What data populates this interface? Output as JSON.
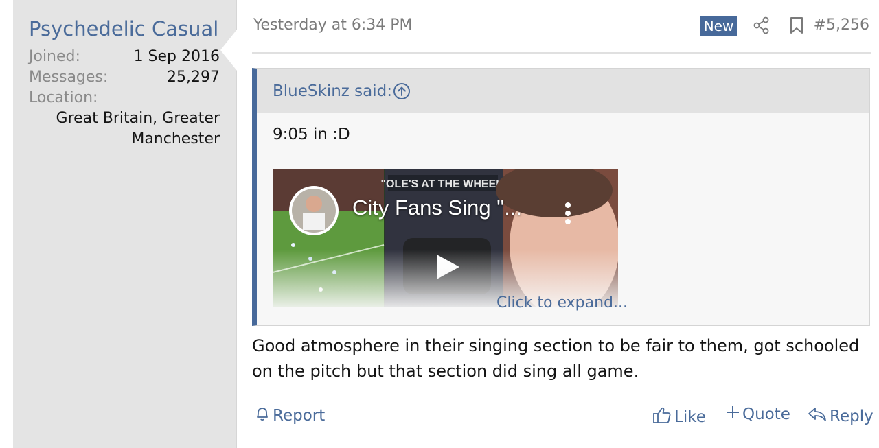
{
  "user": {
    "name": "Psychedelic Casual",
    "joined_label": "Joined:",
    "joined_value": "1 Sep 2016",
    "messages_label": "Messages:",
    "messages_value": "25,297",
    "location_label": "Location:",
    "location_line1": "Great Britain, Greater",
    "location_line2": "Manchester"
  },
  "post": {
    "date": "Yesterday at 6:34 PM",
    "new_badge": "New",
    "number": "#5,256",
    "body": "Good atmosphere in their singing section to be fair to them, got schooled on the pitch but that section did sing all game."
  },
  "quote": {
    "author_said": "BlueSkinz said:",
    "text": "9:05 in :D",
    "video_title": "City Fans Sing \"...",
    "video_banner": "\"OLE'S AT THE WHEEL\"",
    "expand_label": "Click to expand..."
  },
  "actions": {
    "report": "Report",
    "like": "Like",
    "quote": "Quote",
    "reply": "Reply"
  },
  "colors": {
    "accent": "#47699a",
    "link": "#4a6b9a",
    "sidebar_bg": "#e4e4e4"
  },
  "icons": [
    "share-icon",
    "bookmark-icon",
    "circle-arrow-up-icon",
    "bell-icon",
    "thumbs-up-icon",
    "plus-icon",
    "reply-icon",
    "play-icon",
    "kebab-menu-icon"
  ]
}
